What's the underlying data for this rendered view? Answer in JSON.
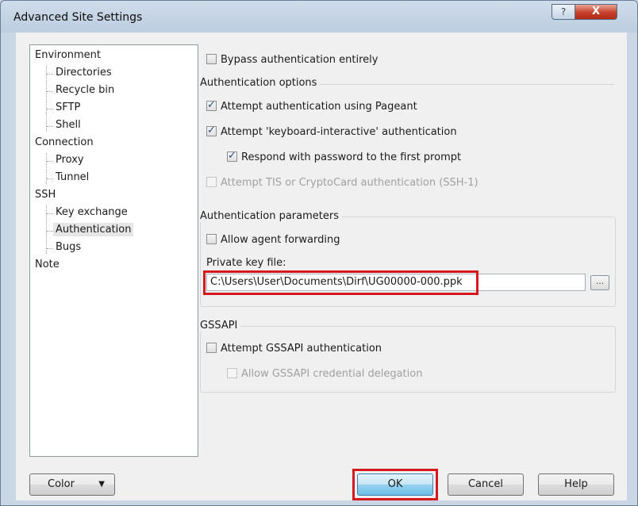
{
  "window": {
    "title": "Advanced Site Settings",
    "help_glyph": "?",
    "close_glyph": "X"
  },
  "tree": {
    "items": [
      {
        "label": "Environment"
      },
      {
        "label": "Directories"
      },
      {
        "label": "Recycle bin"
      },
      {
        "label": "SFTP"
      },
      {
        "label": "Shell"
      },
      {
        "label": "Connection"
      },
      {
        "label": "Proxy"
      },
      {
        "label": "Tunnel"
      },
      {
        "label": "SSH"
      },
      {
        "label": "Key exchange"
      },
      {
        "label": "Authentication",
        "selected": true
      },
      {
        "label": "Bugs"
      },
      {
        "label": "Note"
      }
    ]
  },
  "auth": {
    "bypass": {
      "label": "Bypass authentication entirely",
      "checked": false
    },
    "options_group": "Authentication options",
    "pageant": {
      "label": "Attempt authentication using Pageant",
      "checked": true
    },
    "keyboard_interactive": {
      "label": "Attempt 'keyboard-interactive' authentication",
      "checked": true
    },
    "respond_password": {
      "label": "Respond with password to the first prompt",
      "checked": true
    },
    "tis_cryptocard": {
      "label": "Attempt TIS or CryptoCard authentication (SSH-1)",
      "checked": false,
      "disabled": true
    },
    "params_group": "Authentication parameters",
    "agent_forwarding": {
      "label": "Allow agent forwarding",
      "checked": false
    },
    "private_key_label": "Private key file:",
    "private_key_value": "C:\\Users\\User\\Documents\\Dirf\\UG00000-000.ppk",
    "browse_label": "...",
    "gssapi_group": "GSSAPI",
    "gssapi_attempt": {
      "label": "Attempt GSSAPI authentication",
      "checked": false
    },
    "gssapi_delegation": {
      "label": "Allow GSSAPI credential delegation",
      "checked": false,
      "disabled": true
    }
  },
  "buttons": {
    "color": "Color",
    "color_arrow": "▼",
    "ok": "OK",
    "cancel": "Cancel",
    "help": "Help"
  },
  "colors": {
    "highlight": "#d6191f",
    "ok_button": "#98d1ef"
  }
}
